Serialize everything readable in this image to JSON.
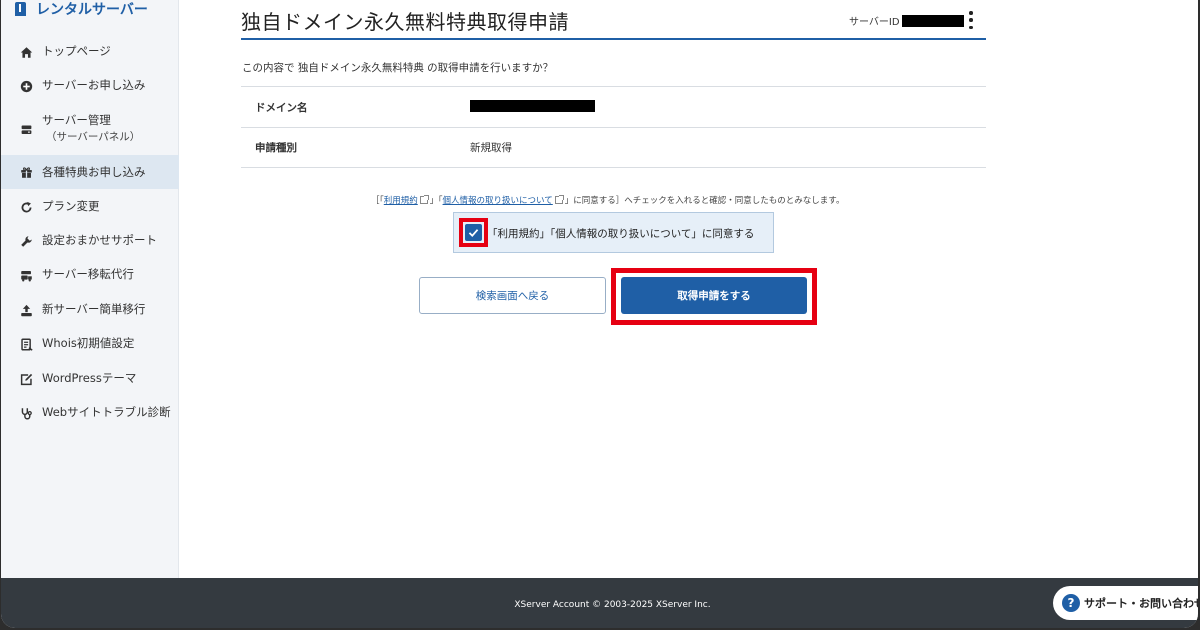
{
  "brand": {
    "logo_text": "レンタルサーバー"
  },
  "sidebar": {
    "items": [
      {
        "label": "トップページ",
        "icon": "home-icon"
      },
      {
        "label": "サーバーお申し込み",
        "icon": "plus-circle-icon"
      },
      {
        "label": "サーバー管理",
        "sub": "（サーバーパネル）",
        "icon": "server-icon"
      },
      {
        "label": "各種特典お申し込み",
        "icon": "gift-icon",
        "active": true
      },
      {
        "label": "プラン変更",
        "icon": "refresh-icon"
      },
      {
        "label": "設定おまかせサポート",
        "icon": "wrench-icon"
      },
      {
        "label": "サーバー移転代行",
        "icon": "truck-icon"
      },
      {
        "label": "新サーバー簡単移行",
        "icon": "upload-icon"
      },
      {
        "label": "Whois初期値設定",
        "icon": "document-icon"
      },
      {
        "label": "WordPressテーマ",
        "icon": "edit-icon"
      },
      {
        "label": "Webサイトトラブル診断",
        "icon": "stethoscope-icon"
      }
    ]
  },
  "header": {
    "title": "独自ドメイン永久無料特典取得申請",
    "server_id_label": "サーバーID"
  },
  "main": {
    "confirm_text": "この内容で 独自ドメイン永久無料特典 の取得申請を行いますか？",
    "rows": [
      {
        "key": "ドメイン名",
        "value": ""
      },
      {
        "key": "申請種別",
        "value": "新規取得"
      }
    ],
    "terms": {
      "prefix": "［「",
      "link1": "利用規約",
      "middle": "」「",
      "link2": "個人情報の取り扱いについて",
      "suffix": "」に同意する］へチェックを入れると確認・同意したものとみなします。"
    },
    "agree_label": "「利用規約」「個人情報の取り扱いについて」に同意する",
    "agree_checked": true,
    "back_button": "検索画面へ戻る",
    "submit_button": "取得申請をする"
  },
  "footer": {
    "copyright": "XServer Account © 2003-2025 XServer Inc.",
    "support_label": "サポート・お問い合わせ"
  },
  "colors": {
    "accent": "#1f5fa6",
    "highlight": "#e60012",
    "footer": "#343a40"
  }
}
